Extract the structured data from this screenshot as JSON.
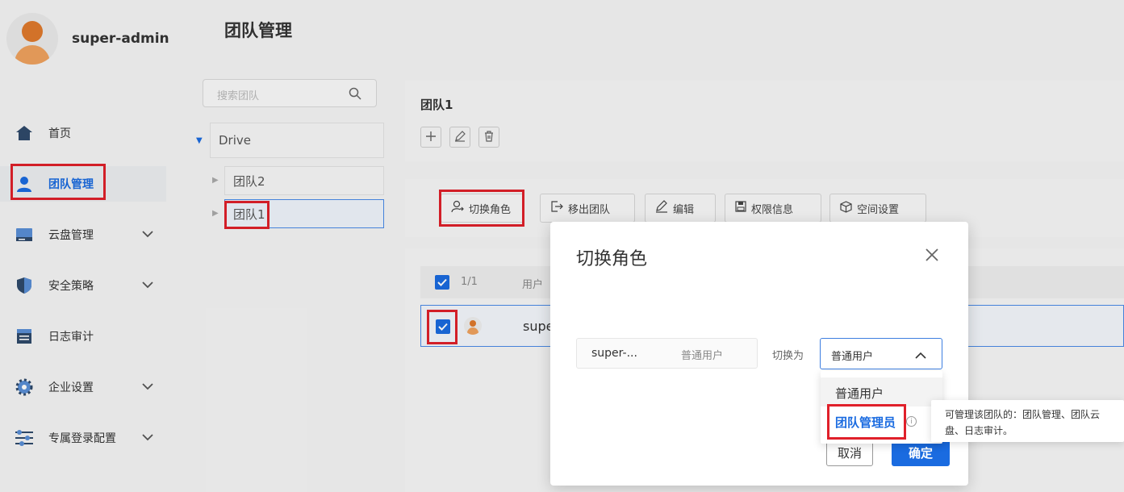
{
  "user": {
    "name": "super-admin"
  },
  "sidebar": {
    "items": [
      {
        "label": "首页",
        "icon": "home-icon"
      },
      {
        "label": "团队管理",
        "icon": "user-icon",
        "active": true
      },
      {
        "label": "云盘管理",
        "icon": "drive-icon",
        "expandable": true
      },
      {
        "label": "安全策略",
        "icon": "shield-icon",
        "expandable": true
      },
      {
        "label": "日志审计",
        "icon": "log-icon"
      },
      {
        "label": "企业设置",
        "icon": "gear-icon",
        "expandable": true
      },
      {
        "label": "专属登录配置",
        "icon": "sliders-icon",
        "expandable": true
      }
    ]
  },
  "page": {
    "title": "团队管理"
  },
  "tree": {
    "search_placeholder": "搜索团队",
    "root": "Drive",
    "children": [
      "团队2",
      "团队1"
    ]
  },
  "team": {
    "name": "团队1"
  },
  "actions": [
    "切换角色",
    "移出团队",
    "编辑",
    "权限信息",
    "空间设置"
  ],
  "table": {
    "count": "1/1",
    "user_header": "用户",
    "row_user": "supe"
  },
  "modal": {
    "title": "切换角色",
    "user_name": "super-...",
    "user_role": "普通用户",
    "switch_label": "切换为",
    "selected": "普通用户",
    "cancel": "取消",
    "confirm": "确定"
  },
  "dropdown": {
    "options": [
      "普通用户",
      "团队管理员"
    ],
    "tooltip": "可管理该团队的：团队管理、团队云盘、日志审计。"
  },
  "colors": {
    "accent": "#1a6be0",
    "highlight": "#e0202a"
  }
}
